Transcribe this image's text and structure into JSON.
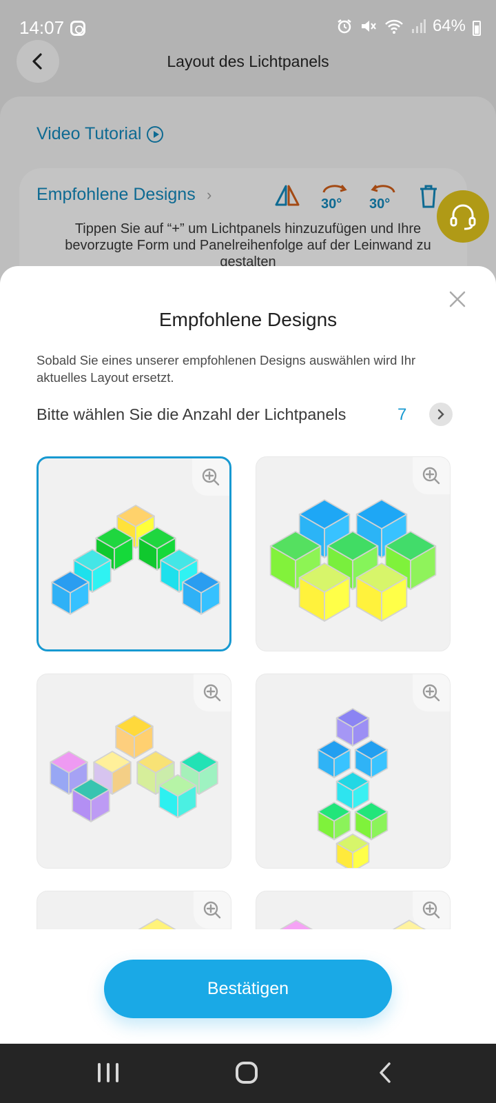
{
  "status_bar": {
    "time": "14:07",
    "battery": "64%"
  },
  "header": {
    "title": "Layout des Lichtpanels"
  },
  "background": {
    "video_tutorial": "Video Tutorial",
    "recommended_link": "Empfohlene Designs",
    "rotate_left_label": "30°",
    "rotate_right_label": "30°",
    "hint": "Tippen Sie auf “+” um Lichtpanels hinzuzufügen und Ihre bevorzugte Form und Panelreihenfolge auf der Leinwand zu gestalten"
  },
  "sheet": {
    "title": "Empfohlene Designs",
    "description": "Sobald Sie eines unserer empfohlenen Designs auswählen wird Ihr aktuelles Layout ersetzt.",
    "count_label": "Bitte wählen Sie die Anzahl der Lichtpanels",
    "count_value": "7",
    "confirm_label": "Bestätigen",
    "designs": [
      {
        "selected": true,
        "cubes": [
          {
            "top": "#ffd26b",
            "left": "#ffe23a",
            "right": "#ffff3a"
          },
          {
            "top": "#1fd63f",
            "left": "#10c82e",
            "right": "#15d93a"
          },
          {
            "top": "#1fd63f",
            "left": "#10c82e",
            "right": "#15d93a"
          },
          {
            "top": "#44e6e6",
            "left": "#1ee0ec",
            "right": "#2ff2f2"
          },
          {
            "top": "#44e6e6",
            "left": "#1ee0ec",
            "right": "#2ff2f2"
          },
          {
            "top": "#2a9df0",
            "left": "#2fb1f6",
            "right": "#36c1ff"
          },
          {
            "top": "#2a9df0",
            "left": "#2fb1f6",
            "right": "#36c1ff"
          }
        ]
      },
      {
        "selected": false,
        "cubes": [
          {
            "top": "#1ea7f5",
            "left": "#2bb4f6",
            "right": "#38c2ff"
          },
          {
            "top": "#1ea7f5",
            "left": "#2bb4f6",
            "right": "#38c2ff"
          },
          {
            "top": "#55e060",
            "left": "#82f23b",
            "right": "#8df454"
          },
          {
            "top": "#41dc64",
            "left": "#79ef3d",
            "right": "#86f45a"
          },
          {
            "top": "#42dc6a",
            "left": "#7ff23b",
            "right": "#8ff35b"
          },
          {
            "top": "#d7f56a",
            "left": "#fff23c",
            "right": "#ffff48"
          },
          {
            "top": "#d7f56a",
            "left": "#fff23c",
            "right": "#ffff48"
          }
        ]
      },
      {
        "selected": false,
        "cubes": [
          {
            "top": "#ffd93b",
            "left": "#fdcf7e",
            "right": "#ffd070"
          },
          {
            "top": "#ee9af2",
            "left": "#98a7f4",
            "right": "#a6a2f4"
          },
          {
            "top": "#fff09a",
            "left": "#d7c4ef",
            "right": "#f4cf86"
          },
          {
            "top": "#f8e275",
            "left": "#d6ee9a",
            "right": "#cbecaa"
          },
          {
            "top": "#22e2b5",
            "left": "#a5f0b9",
            "right": "#9ef2c1"
          },
          {
            "top": "#37c4b0",
            "left": "#b38ff4",
            "right": "#bd9bf4"
          },
          {
            "top": "#b6f4a6",
            "left": "#2df0f0",
            "right": "#4bf0e2"
          }
        ]
      },
      {
        "selected": false,
        "cubes": [
          {
            "top": "#8b84f3",
            "left": "#a597f5",
            "right": "#9c8ff4"
          },
          {
            "top": "#229ff0",
            "left": "#2fb3f6",
            "right": "#39c3ff"
          },
          {
            "top": "#229ff0",
            "left": "#2fb3f6",
            "right": "#39c3ff"
          },
          {
            "top": "#22d7e4",
            "left": "#2ee4ef",
            "right": "#3af0f2"
          },
          {
            "top": "#22e57a",
            "left": "#7ff23b",
            "right": "#8bf35a"
          },
          {
            "top": "#22e57a",
            "left": "#7ff23b",
            "right": "#8bf35a"
          },
          {
            "top": "#d7f56a",
            "left": "#ffea3c",
            "right": "#ffff48"
          }
        ]
      },
      {
        "selected": false,
        "cubes": [
          {
            "top": "#fff37a",
            "left": "#d7f4a0",
            "right": "#c6f7a5"
          }
        ]
      },
      {
        "selected": false,
        "cubes": [
          {
            "top": "#f5a3f5",
            "left": "#e88fe8",
            "right": "#6f63f3"
          },
          {
            "top": "#fff3a0",
            "left": "#fff07a",
            "right": "#e6f7a5"
          }
        ]
      }
    ]
  }
}
